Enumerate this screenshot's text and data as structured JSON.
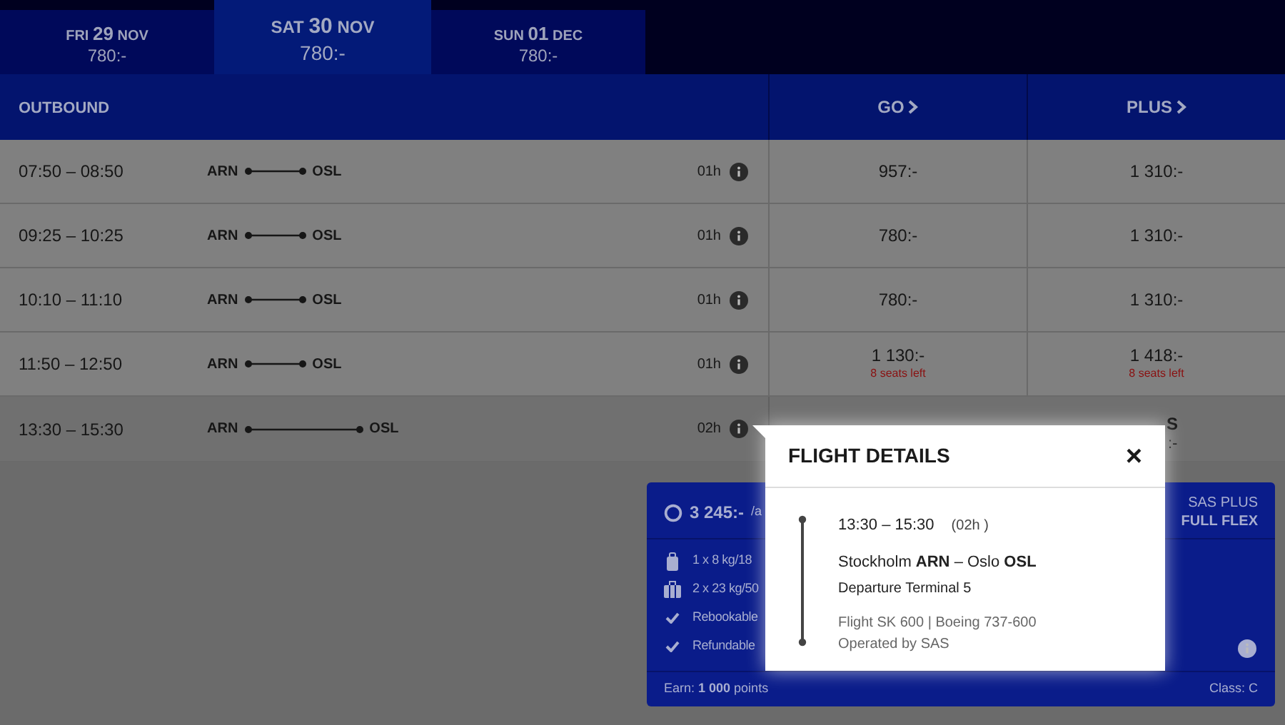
{
  "date_tabs": [
    {
      "day": "FRI",
      "date": "29",
      "month": "NOV",
      "price": "780:-",
      "selected": false
    },
    {
      "day": "SAT",
      "date": "30",
      "month": "NOV",
      "price": "780:-",
      "selected": true
    },
    {
      "day": "SUN",
      "date": "01",
      "month": "DEC",
      "price": "780:-",
      "selected": false
    }
  ],
  "header": {
    "title": "OUTBOUND",
    "fare_columns": [
      "GO",
      "PLUS"
    ]
  },
  "flights": [
    {
      "time": "07:50 – 08:50",
      "from": "ARN",
      "to": "OSL",
      "duration": "01h",
      "selected": false,
      "fares": [
        {
          "price": "957:-"
        },
        {
          "price": "1 310:-"
        }
      ]
    },
    {
      "time": "09:25 – 10:25",
      "from": "ARN",
      "to": "OSL",
      "duration": "01h",
      "selected": false,
      "fares": [
        {
          "price": "780:-"
        },
        {
          "price": "1 310:-"
        }
      ]
    },
    {
      "time": "10:10 – 11:10",
      "from": "ARN",
      "to": "OSL",
      "duration": "01h",
      "selected": false,
      "fares": [
        {
          "price": "780:-"
        },
        {
          "price": "1 310:-"
        }
      ]
    },
    {
      "time": "11:50 – 12:50",
      "from": "ARN",
      "to": "OSL",
      "duration": "01h",
      "selected": false,
      "fares": [
        {
          "price": "1 130:-",
          "note": "8 seats left"
        },
        {
          "price": "1 418:-",
          "note": "8 seats left"
        }
      ]
    },
    {
      "time": "13:30 – 15:30",
      "from": "ARN",
      "to": "OSL",
      "duration": "02h",
      "selected": true,
      "covered_fare": {
        "line_1": "S",
        "line_2": ":-"
      }
    }
  ],
  "selected_fare": {
    "price": "3 245:-",
    "per": "/a",
    "brand": "SAS PLUS",
    "fare_type": "FULL FLEX",
    "features": [
      {
        "kind": "cabin_bag",
        "text": "1 x 8 kg/18"
      },
      {
        "kind": "checked_bag",
        "text": "2 x 23 kg/50"
      },
      {
        "kind": "check",
        "text": "Rebookable"
      },
      {
        "kind": "check",
        "text": "Refundable"
      }
    ],
    "earn": "Earn: **1 000** points",
    "class": "Class: C"
  },
  "flight_details": {
    "title": "FLIGHT DETAILS",
    "close": "×",
    "times": "13:30 – 15:30",
    "duration": "(02h )",
    "route": "Stockholm **ARN** – Oslo **OSL**",
    "terminal": "Departure Terminal 5",
    "flight": "Flight SK 600 | Boeing 737-600",
    "operator": "Operated by SAS"
  }
}
